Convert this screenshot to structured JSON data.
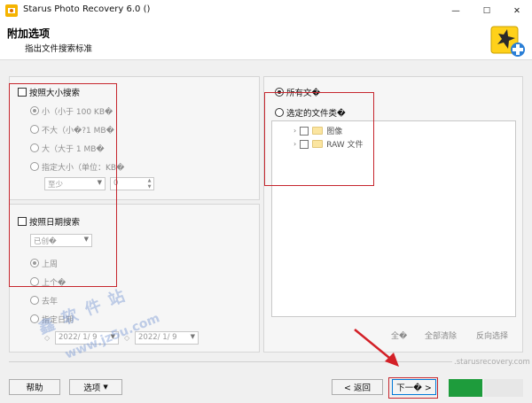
{
  "window": {
    "title": "Starus Photo Recovery 6.0 ()",
    "controls": {
      "minimize": "—",
      "maximize": "☐",
      "close": "✕"
    }
  },
  "header": {
    "title": "附加选项",
    "subtitle": "指出文件搜索标准"
  },
  "size_search": {
    "label": "按照大小搜索",
    "options": [
      "小（小于 100 KB�",
      "不大（小�?1 MB�",
      "大（大于 1 MB�",
      "指定大小（单位：KB�"
    ],
    "selected": 0,
    "min_select": "至少",
    "min_value": "0"
  },
  "date_search": {
    "label": "按照日期搜索",
    "type_select": "已创�",
    "options": [
      "上周",
      "上个�",
      "去年",
      "指定日期"
    ],
    "selected": 0,
    "date_from": "2022/ 1/ 9",
    "date_to": "2022/ 1/ 9"
  },
  "file_types": {
    "all_label": "所有文�",
    "selected_label": "选定的文件类�",
    "tree": [
      {
        "label": "图像"
      },
      {
        "label": "RAW 文件"
      }
    ],
    "actions": [
      "全�",
      "全部清除",
      "反向选择"
    ]
  },
  "footer": {
    "help": "帮助",
    "options": "选项",
    "back": "< 返回",
    "next": "下一� >",
    "url": ".starusrecovery.com"
  },
  "watermark": {
    "line1": "鑫 软 件 站",
    "line2": "www.jz5u.com"
  },
  "colors": {
    "highlight_box": "#c6262e",
    "arrow": "#d32027",
    "next_focus": "#0078d7"
  }
}
